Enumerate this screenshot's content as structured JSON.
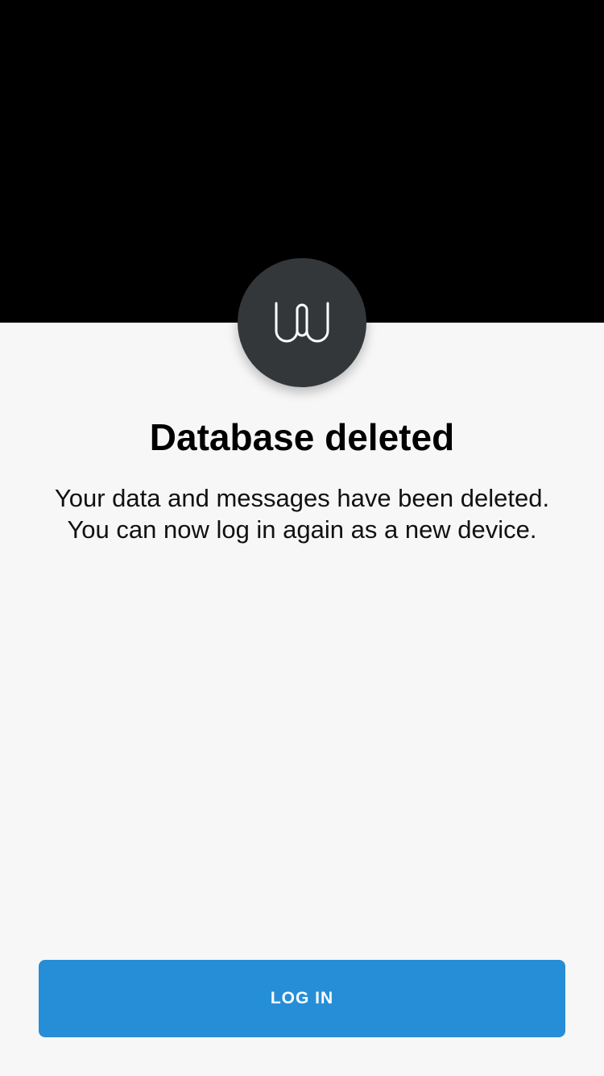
{
  "header": {
    "banner_color": "#000000",
    "logo": {
      "icon": "wire-logo-icon",
      "badge_color": "#33373a"
    }
  },
  "main": {
    "title": "Database deleted",
    "message_lines": [
      "Your data and messages have been deleted.",
      "You can now log in again as a new device."
    ]
  },
  "footer": {
    "login_button_label": "LOG IN",
    "login_button_color": "#268ed6"
  }
}
